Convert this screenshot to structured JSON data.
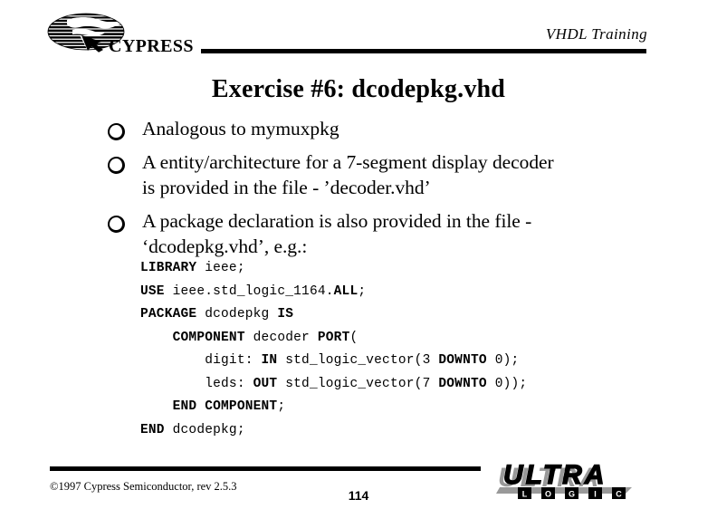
{
  "header": {
    "brand_logo": "cypress-logo",
    "brand_name": "CYPRESS",
    "course_title": "VHDL Training"
  },
  "title": "Exercise #6: dcodepkg.vhd",
  "bullets": [
    {
      "marker": "hollow-circle-bullet",
      "lines": [
        "Analogous to mymuxpkg"
      ]
    },
    {
      "marker": "hollow-circle-bullet",
      "lines": [
        "A entity/architecture for a 7-segment display decoder",
        "is provided in the file - ’decoder.vhd’"
      ]
    },
    {
      "marker": "hollow-circle-bullet",
      "lines": [
        "A package declaration is also provided in the file -",
        "‘dcodepkg.vhd’, e.g.:"
      ]
    }
  ],
  "code": {
    "language": "vhdl",
    "lines": [
      [
        {
          "t": "LIBRARY",
          "b": true
        },
        {
          "t": " ieee;",
          "b": false
        }
      ],
      [
        {
          "t": "USE",
          "b": true
        },
        {
          "t": " ieee.std_logic_1164.",
          "b": false
        },
        {
          "t": "ALL",
          "b": true
        },
        {
          "t": ";",
          "b": false
        }
      ],
      [
        {
          "t": "PACKAGE",
          "b": true
        },
        {
          "t": " dcodepkg ",
          "b": false
        },
        {
          "t": "IS",
          "b": true
        }
      ],
      [
        {
          "t": "    ",
          "b": false
        },
        {
          "t": "COMPONENT",
          "b": true
        },
        {
          "t": " decoder ",
          "b": false
        },
        {
          "t": "PORT",
          "b": true
        },
        {
          "t": "(",
          "b": false
        }
      ],
      [
        {
          "t": "        digit: ",
          "b": false
        },
        {
          "t": "IN",
          "b": true
        },
        {
          "t": " std_logic_vector(3 ",
          "b": false
        },
        {
          "t": "DOWNTO",
          "b": true
        },
        {
          "t": " 0);",
          "b": false
        }
      ],
      [
        {
          "t": "        leds: ",
          "b": false
        },
        {
          "t": "OUT",
          "b": true
        },
        {
          "t": " std_logic_vector(7 ",
          "b": false
        },
        {
          "t": "DOWNTO",
          "b": true
        },
        {
          "t": " 0));",
          "b": false
        }
      ],
      [
        {
          "t": "    ",
          "b": false
        },
        {
          "t": "END COMPONENT",
          "b": true
        },
        {
          "t": ";",
          "b": false
        }
      ],
      [
        {
          "t": "END",
          "b": true
        },
        {
          "t": " dcodepkg;",
          "b": false
        }
      ]
    ]
  },
  "footer": {
    "copyright": "©1997 Cypress Semiconductor, rev 2.5.3",
    "page_number": "114",
    "logo_primary": "ULTRA",
    "logo_secondary_letters": [
      "L",
      "O",
      "G",
      "I",
      "C"
    ]
  },
  "colors": {
    "ink": "#000000",
    "paper": "#ffffff",
    "logo_shadow": "#999999"
  }
}
